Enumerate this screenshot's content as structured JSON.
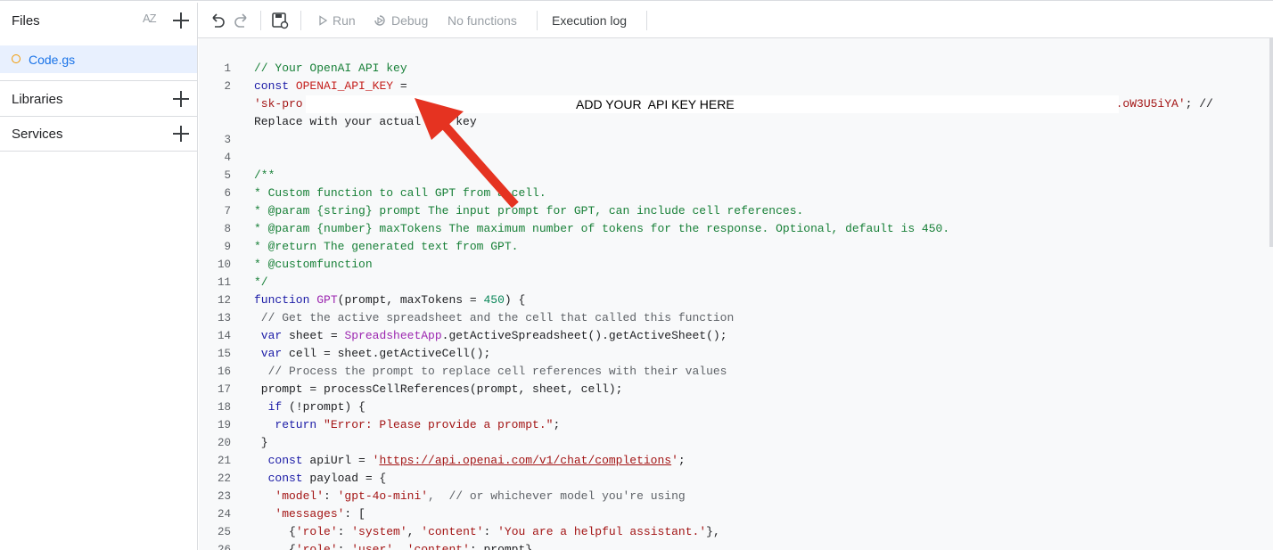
{
  "sidebar": {
    "files_title": "Files",
    "sort_icon_text": "AZ",
    "file_name": "Code.gs",
    "libraries_title": "Libraries",
    "services_title": "Services"
  },
  "toolbar": {
    "run_label": "Run",
    "debug_label": "Debug",
    "functions_label": "No functions",
    "execution_log_label": "Execution log"
  },
  "annotation": {
    "note": "ADD YOUR  API KEY HERE",
    "arrow_color": "#e53321"
  },
  "code": {
    "line_numbers": [
      "1",
      "2",
      "",
      "3",
      "4",
      "5",
      "6",
      "7",
      "8",
      "9",
      "10",
      "11",
      "12",
      "13",
      "14",
      "15",
      "16",
      "17",
      "18",
      "19",
      "20",
      "21",
      "22",
      "23",
      "24",
      "25",
      "26"
    ],
    "l1": "// Your OpenAI API key",
    "l2_kw": "const",
    "l2_var": "OPENAI_API_KEY",
    "l2_eq": " =",
    "l2b_start": "'sk-pro",
    "l2b_end": ".oW3U5iYA'",
    "l2b_rest": "; //",
    "l2c": "Replace with your actual API key",
    "l5": "/**",
    "l6": "* Custom function to call GPT from a cell.",
    "l7": "* @param {string} prompt The input prompt for GPT, can include cell references.",
    "l8": "* @param {number} maxTokens The maximum number of tokens for the response. Optional, default is 450.",
    "l9": "* @return The generated text from GPT.",
    "l10": "* @customfunction",
    "l11": "*/",
    "l12_kw": "function",
    "l12_fn": "GPT",
    "l12_args": "(prompt, maxTokens = ",
    "l12_num": "450",
    "l12_end": ") {",
    "l13": " // Get the active spreadsheet and the cell that called this function",
    "l14_kw": " var",
    "l14_a": " sheet = ",
    "l14_cls": "SpreadsheetApp",
    "l14_b": ".getActiveSpreadsheet().getActiveSheet();",
    "l15_kw": " var",
    "l15_a": " cell = sheet.getActiveCell();",
    "l16": "  // Process the prompt to replace cell references with their values",
    "l17": " prompt = processCellReferences(prompt, sheet, cell);",
    "l18_kw": "  if",
    "l18_a": " (!prompt) {",
    "l19_kw": "   return",
    "l19_s": " \"Error: Please provide a prompt.\"",
    "l19_e": ";",
    "l20": " }",
    "l21_kw": "  const",
    "l21_a": " apiUrl = ",
    "l21_q1": "'",
    "l21_url": "https://api.openai.com/v1/chat/completions",
    "l21_q2": "'",
    "l21_e": ";",
    "l22_kw": "  const",
    "l22_a": " payload = {",
    "l23_s1": "   'model'",
    "l23_a": ": ",
    "l23_s2": "'gpt-4o-mini'",
    "l23_c": ",  // or whichever model you're using",
    "l24_s": "   'messages'",
    "l24_a": ": [",
    "l25_a": "     {",
    "l25_s1": "'role'",
    "l25_b": ": ",
    "l25_s2": "'system'",
    "l25_c": ", ",
    "l25_s3": "'content'",
    "l25_d": ": ",
    "l25_s4": "'You are a helpful assistant.'",
    "l25_e": "},",
    "l26_a": "     {",
    "l26_s1": "'role'",
    "l26_b": ": ",
    "l26_s2": "'user'",
    "l26_c": ", ",
    "l26_s3": "'content'",
    "l26_d": ": prompt},"
  }
}
